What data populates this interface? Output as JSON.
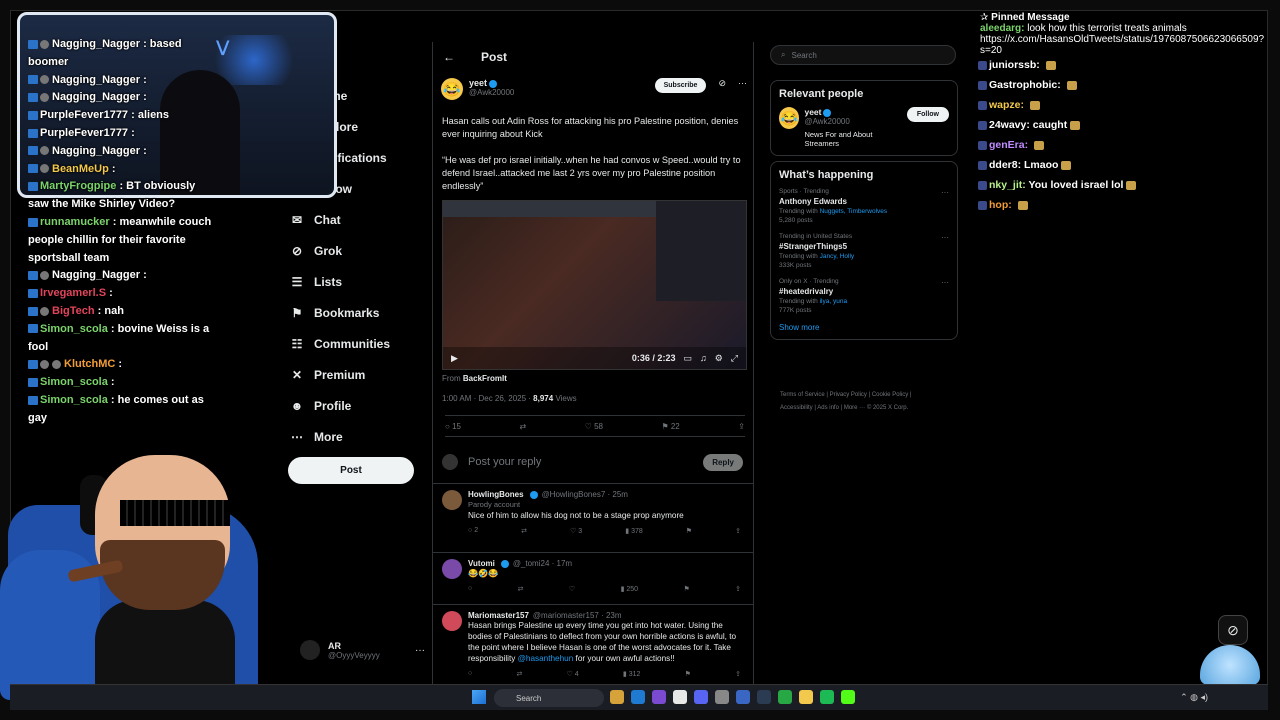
{
  "nav": {
    "items": [
      {
        "label": "Home",
        "icon": "home-icon"
      },
      {
        "label": "Explore",
        "icon": "search-icon"
      },
      {
        "label": "Notifications",
        "icon": "bell-icon"
      },
      {
        "label": "Follow",
        "icon": "person-icon"
      },
      {
        "label": "Chat",
        "icon": "mail-icon"
      },
      {
        "label": "Grok",
        "icon": "grok-icon"
      },
      {
        "label": "Lists",
        "icon": "list-icon"
      },
      {
        "label": "Bookmarks",
        "icon": "bookmark-icon"
      },
      {
        "label": "Communities",
        "icon": "people-icon"
      },
      {
        "label": "Premium",
        "icon": "x-logo-icon"
      },
      {
        "label": "Profile",
        "icon": "profile-icon"
      },
      {
        "label": "More",
        "icon": "more-circle-icon"
      }
    ],
    "post_label": "Post",
    "me": {
      "name": "AR",
      "handle": "@OyyyVeyyyy"
    }
  },
  "post": {
    "header": "Post",
    "author_name": "yeet",
    "author_handle": "@Awk20000",
    "subscribe_label": "Subscribe",
    "text": "Hasan calls out Adin Ross for attacking his pro Palestine position, denies ever inquiring about Kick\n\n“He was def pro israel initially..when he had convos w Speed..would try to defend Israel..attacked me last 2 yrs over my pro Palestine position endlessly”",
    "video_time": "0:36 / 2:23",
    "from_label": "From",
    "from_source": "BackFromIt",
    "timestamp": "1:00 AM · Dec 26, 2025 ·",
    "views_count": "8,974",
    "views_label": "Views",
    "replies": "15",
    "likes": "58",
    "bookmarks": "22",
    "reply_placeholder": "Post your reply",
    "reply_button": "Reply"
  },
  "comments": [
    {
      "name": "HowlingBones",
      "handle": "@HowlingBones7 · 25m",
      "tag": "Parody account",
      "text": "Nice of him to allow his dog not to be a stage prop anymore",
      "replies": "2",
      "likes": "3",
      "views": "378",
      "color": "#7a5a3a"
    },
    {
      "name": "Vutomi",
      "handle": "@_tomi24 · 17m",
      "tag": "",
      "text": "😂🤣😂",
      "replies": "",
      "likes": "",
      "views": "250",
      "color": "#7a4aa8"
    },
    {
      "name": "Mariomaster157",
      "handle": "@mariomaster157 · 23m",
      "tag": "",
      "text": "Hasan brings Palestine up every time you get into hot water. Using the bodies of Palestinians to deflect from your own horrible actions is awful, to the point where I believe Hasan is one of the worst advocates for it. Take responsibility",
      "mention": "@hasanthehun",
      "text_after": " for your own awful actions!!",
      "replies": "",
      "likes": "4",
      "views": "312",
      "color": "#d04a5a"
    }
  ],
  "sidebar": {
    "search_placeholder": "Search",
    "relevant_title": "Relevant people",
    "relevant": {
      "name": "yeet",
      "handle": "@Awk20000",
      "bio": "News For and About Streamers",
      "follow_label": "Follow"
    },
    "happening_title": "What’s happening",
    "trends": [
      {
        "context": "Sports · Trending",
        "title": "Anthony Edwards",
        "with_label": "Trending with",
        "with": "Nuggets, Timberwolves",
        "posts": "5,280 posts"
      },
      {
        "context": "Trending in United States",
        "title": "#StrangerThings5",
        "with_label": "Trending with",
        "with": "Jancy, Holly",
        "posts": "333K posts"
      },
      {
        "context": "Only on X · Trending",
        "title": "#heatedrivalry",
        "with_label": "Trending with",
        "with": "ilya, yuna",
        "posts": "777K posts"
      }
    ],
    "show_more": "Show more",
    "footer": [
      "Terms of Service",
      "Privacy Policy",
      "Cookie Policy",
      "Accessibility",
      "Ads info",
      "More ···",
      "© 2025 X Corp."
    ]
  },
  "chat": [
    {
      "user": "Nagging_Nagger",
      "text": " : based boomer",
      "color": "#ffffff",
      "badges": 2
    },
    {
      "user": "Nagging_Nagger",
      "text": " : ",
      "color": "#ffffff",
      "badges": 2
    },
    {
      "user": "Nagging_Nagger",
      "text": " : ",
      "color": "#ffffff",
      "badges": 2
    },
    {
      "user": "PurpleFever1777",
      "text": " : aliens",
      "color": "#ffffff",
      "badges": 1
    },
    {
      "user": "PurpleFever1777",
      "text": " : ",
      "color": "#ffffff",
      "badges": 1
    },
    {
      "user": "Nagging_Nagger",
      "text": " : ",
      "color": "#ffffff",
      "badges": 2
    },
    {
      "user": "BeanMeUp",
      "text": " : ",
      "color": "#f2c94c",
      "badges": 2
    },
    {
      "user": "MartyFrogpipe",
      "text": " : BT obviously saw the Mike Shirley Video?",
      "color": "#7bd36b",
      "badges": 1
    },
    {
      "user": "runnamucker",
      "text": " : meanwhile couch people chillin for their favorite sportsball team",
      "color": "#7bd36b",
      "badges": 1
    },
    {
      "user": "Nagging_Nagger",
      "text": " : ",
      "color": "#ffffff",
      "badges": 2
    },
    {
      "user": "Irvegamerl.S",
      "text": " : ",
      "color": "#e2445b",
      "badges": 1
    },
    {
      "user": "BigTech",
      "text": " : nah",
      "color": "#e2445b",
      "badges": 2
    },
    {
      "user": "Simon_scola",
      "text": " : bovine Weiss is a fool",
      "color": "#7bd36b",
      "badges": 1
    },
    {
      "user": "KlutchMC",
      "text": " : ",
      "color": "#f29c38",
      "badges": 3
    },
    {
      "user": "Simon_scola",
      "text": " : ",
      "color": "#7bd36b",
      "badges": 1
    },
    {
      "user": "Simon_scola",
      "text": " : he comes out as gay",
      "color": "#7bd36b",
      "badges": 1
    }
  ],
  "pinned": {
    "label": "Pinned Message",
    "user": "aleedarg:",
    "text": "look how this terrorist treats animals https://x.com/HasansOldTweets/status/1976087506623066509?s=20"
  },
  "rchat": [
    {
      "user": "juniorssb:",
      "text": "",
      "color": "#ffffff"
    },
    {
      "user": "Gastrophobic:",
      "text": "",
      "color": "#ffffff"
    },
    {
      "user": "wapze:",
      "text": "",
      "color": "#f2c94c"
    },
    {
      "user": "24wavy:",
      "text": "caught",
      "color": "#ffffff"
    },
    {
      "user": "genEra:",
      "text": "",
      "color": "#c08cff"
    },
    {
      "user": "dder8:",
      "text": "Lmaoo",
      "color": "#ffffff"
    },
    {
      "user": "nky_jit:",
      "text": "You loved israel lol",
      "color": "#b8f08a"
    },
    {
      "user": "hop:",
      "text": "",
      "color": "#f29c38"
    }
  ],
  "taskbar": {
    "search": "Search"
  }
}
